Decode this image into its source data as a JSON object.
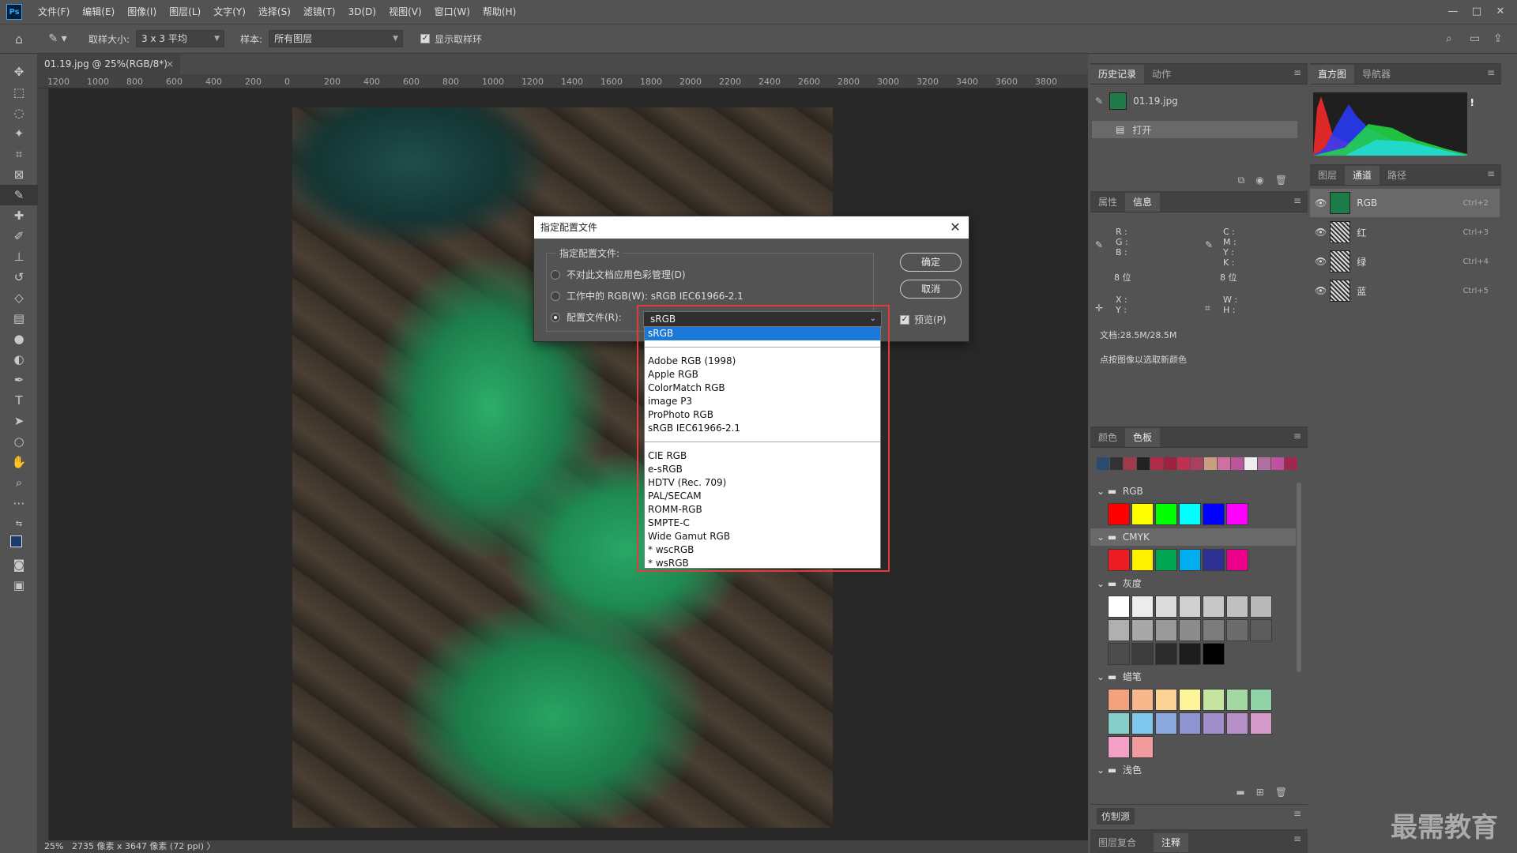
{
  "app": {
    "logo": "Ps"
  },
  "menu": [
    "文件(F)",
    "编辑(E)",
    "图像(I)",
    "图层(L)",
    "文字(Y)",
    "选择(S)",
    "滤镜(T)",
    "3D(D)",
    "视图(V)",
    "窗口(W)",
    "帮助(H)"
  ],
  "window_controls": {
    "minimize": "—",
    "maximize": "□",
    "close": "✕"
  },
  "options_bar": {
    "sample_size_label": "取样大小:",
    "sample_size_value": "3 x 3 平均",
    "sample_label": "样本:",
    "sample_value": "所有图层",
    "show_ring_label": "显示取样环"
  },
  "doc_tab": {
    "title": "01.19.jpg @ 25%(RGB/8*)",
    "close": "×"
  },
  "ruler_ticks": [
    "1200",
    "1000",
    "800",
    "600",
    "400",
    "200",
    "0",
    "200",
    "400",
    "600",
    "800",
    "1000",
    "1200",
    "1400",
    "1600",
    "1800",
    "2000",
    "2200",
    "2400",
    "2600",
    "2800",
    "3000",
    "3200",
    "3400",
    "3600",
    "3800"
  ],
  "status": {
    "zoom": "25%",
    "size": "2735 像素 x 3647 像素 (72 ppi)"
  },
  "dialog": {
    "title": "指定配置文件",
    "group_label": "指定配置文件:",
    "option1": "不对此文档应用色彩管理(D)",
    "option2": "工作中的 RGB(W): sRGB IEC61966-2.1",
    "option3": "配置文件(R):",
    "selected_profile": "sRGB",
    "ok": "确定",
    "cancel": "取消",
    "preview": "预览(P)"
  },
  "profile_list": {
    "top": "sRGB",
    "group1": [
      "Adobe RGB (1998)",
      "Apple RGB",
      "ColorMatch RGB",
      "image P3",
      "ProPhoto RGB",
      "sRGB IEC61966-2.1"
    ],
    "group2": [
      "CIE RGB",
      "e-sRGB",
      "HDTV (Rec. 709)",
      "PAL/SECAM",
      "ROMM-RGB",
      "SMPTE-C",
      "Wide Gamut RGB",
      "* wscRGB",
      "* wsRGB"
    ]
  },
  "history_panel": {
    "tabs": [
      "历史记录",
      "动作"
    ],
    "file": "01.19.jpg",
    "step": "打开"
  },
  "info_panel": {
    "tabs": [
      "属性",
      "信息"
    ],
    "rgb": [
      "R :",
      "G :",
      "B :"
    ],
    "cmyk": [
      "C :",
      "M :",
      "Y :",
      "K :"
    ],
    "bits_left": "8 位",
    "bits_right": "8 位",
    "xy": [
      "X :",
      "Y :"
    ],
    "wh": [
      "W :",
      "H :"
    ],
    "doc": "文档:28.5M/28.5M",
    "hint": "点按图像以选取新颜色"
  },
  "swatches_panel": {
    "tabs": [
      "颜色",
      "色板"
    ],
    "groups": [
      "RGB",
      "CMYK",
      "灰度",
      "蜡笔",
      "浅色"
    ]
  },
  "histogram_panel": {
    "tabs": [
      "直方图",
      "导航器"
    ],
    "warning": "!"
  },
  "channels_panel": {
    "tabs": [
      "图层",
      "通道",
      "路径"
    ],
    "channels": [
      {
        "name": "RGB",
        "shortcut": "Ctrl+2"
      },
      {
        "name": "红",
        "shortcut": "Ctrl+3"
      },
      {
        "name": "绿",
        "shortcut": "Ctrl+4"
      },
      {
        "name": "蓝",
        "shortcut": "Ctrl+5"
      }
    ]
  },
  "bottom_panels": {
    "clone": "仿制源",
    "tabs": [
      "图层复合",
      "注释"
    ]
  },
  "colors": {
    "swatch_rgb": [
      "#ff0000",
      "#ffff00",
      "#00ff00",
      "#00ffff",
      "#0000ff",
      "#ff00ff"
    ],
    "swatch_cmyk": [
      "#ed1c24",
      "#fff200",
      "#00a651",
      "#00aeef",
      "#2e3192",
      "#ec008c"
    ]
  },
  "watermark": "最需教育"
}
